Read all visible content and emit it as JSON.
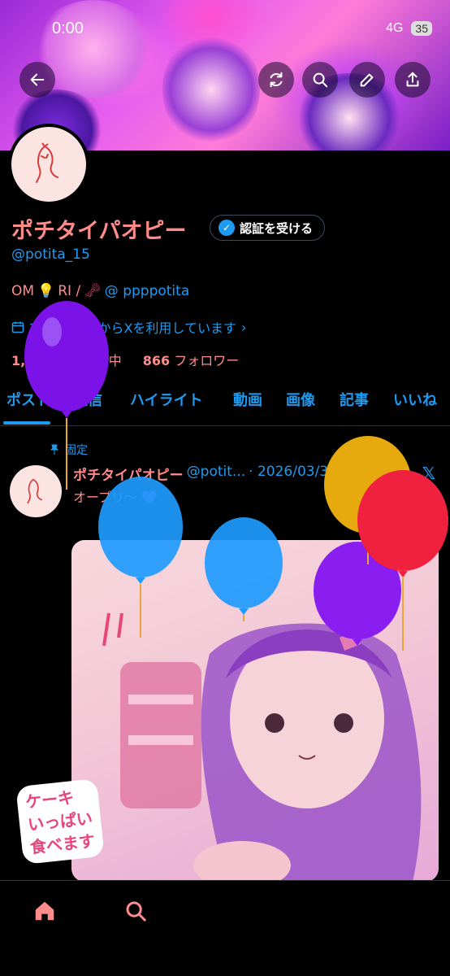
{
  "status_bar": {
    "time": "0:00",
    "network": "4G",
    "battery": "35"
  },
  "header": {
    "back_icon": "arrow-left-icon",
    "actions": [
      "refresh-icon",
      "search-icon",
      "edit-icon",
      "share-icon"
    ]
  },
  "profile": {
    "display_name": "ポチタイパオピー",
    "verify_label": "認証を受ける",
    "handle": "@potita_15",
    "bio_prefix": "OM",
    "bio_middle": "RI /",
    "bio_mention": "@ ppppotita",
    "joined": "20XX年1月からXを利用しています",
    "following_count": "1,757",
    "following_label": "フォロー中",
    "followers_count": "866",
    "followers_label": "フォロワー"
  },
  "tabs": [
    "ポスト",
    "返信",
    "ハイライト",
    "動画",
    "画像",
    "記事",
    "いいね"
  ],
  "active_tab": "ポスト",
  "post": {
    "pinned_label": "固定",
    "author_name": "ポチタイパオピー",
    "author_handle": "@potit...",
    "date": "· 2026/03/30",
    "text": "オープリ～ 💜",
    "sticker_line1": "ケーキ",
    "sticker_line2": "いっぱい",
    "sticker_line3": "食べます"
  },
  "bottom_nav": [
    "home-icon",
    "search-icon"
  ],
  "colors": {
    "accent": "#1d9bf0",
    "name": "#ff8b8b",
    "background": "#000000"
  }
}
